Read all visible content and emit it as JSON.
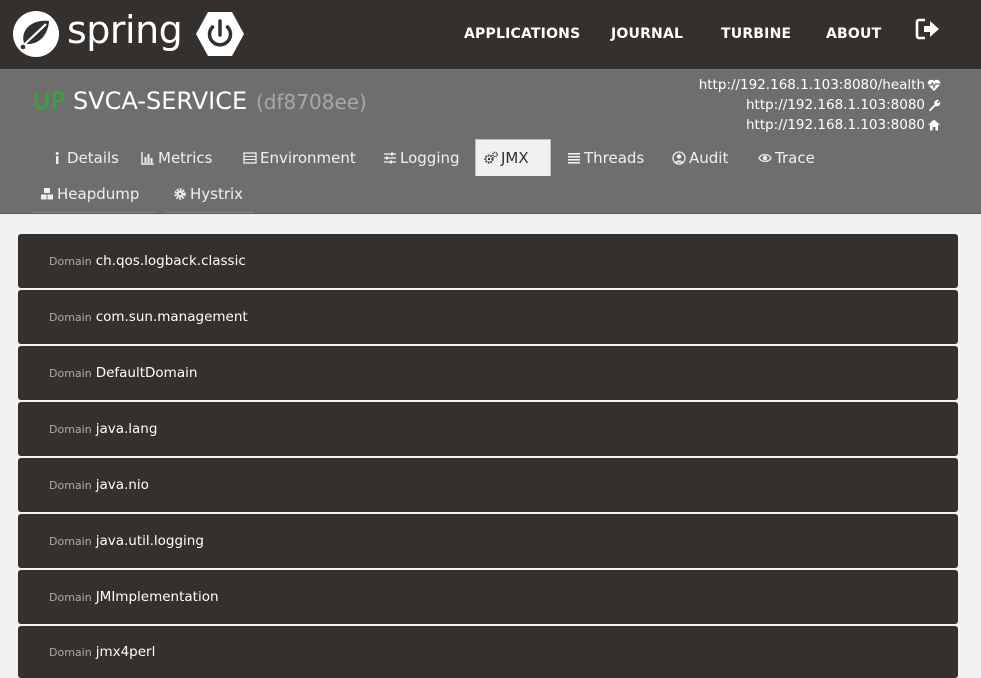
{
  "brand": {
    "name": "spring"
  },
  "nav": {
    "items": [
      "APPLICATIONS",
      "JOURNAL",
      "TURBINE",
      "ABOUT"
    ]
  },
  "app": {
    "status": "UP",
    "name": "SVCA-SERVICE",
    "id": "(df8708ee)",
    "urls": [
      {
        "text": "http://192.168.1.103:8080/health",
        "icon": "heartbeat-icon"
      },
      {
        "text": "http://192.168.1.103:8080",
        "icon": "wrench-icon"
      },
      {
        "text": "http://192.168.1.103:8080",
        "icon": "home-icon"
      }
    ]
  },
  "tabs": [
    {
      "label": "Details",
      "icon": "info-icon"
    },
    {
      "label": "Metrics",
      "icon": "bar-chart-icon"
    },
    {
      "label": "Environment",
      "icon": "list-icon"
    },
    {
      "label": "Logging",
      "icon": "sliders-icon"
    },
    {
      "label": "JMX",
      "icon": "cogs-icon",
      "active": true
    },
    {
      "label": "Threads",
      "icon": "align-justify-icon"
    },
    {
      "label": "Audit",
      "icon": "user-circle-icon"
    },
    {
      "label": "Trace",
      "icon": "eye-icon"
    },
    {
      "label": "Heapdump",
      "icon": "cubes-icon"
    },
    {
      "label": "Hystrix",
      "icon": "gear-icon"
    }
  ],
  "domain_label": "Domain",
  "domains": [
    "ch.qos.logback.classic",
    "com.sun.management",
    "DefaultDomain",
    "java.lang",
    "java.nio",
    "java.util.logging",
    "JMImplementation",
    "jmx4perl"
  ],
  "colors": {
    "nav_bg": "#34302d",
    "header_bg": "#6e6e6e",
    "status_up": "#2eab34",
    "page_bg": "#f1f1f1"
  }
}
